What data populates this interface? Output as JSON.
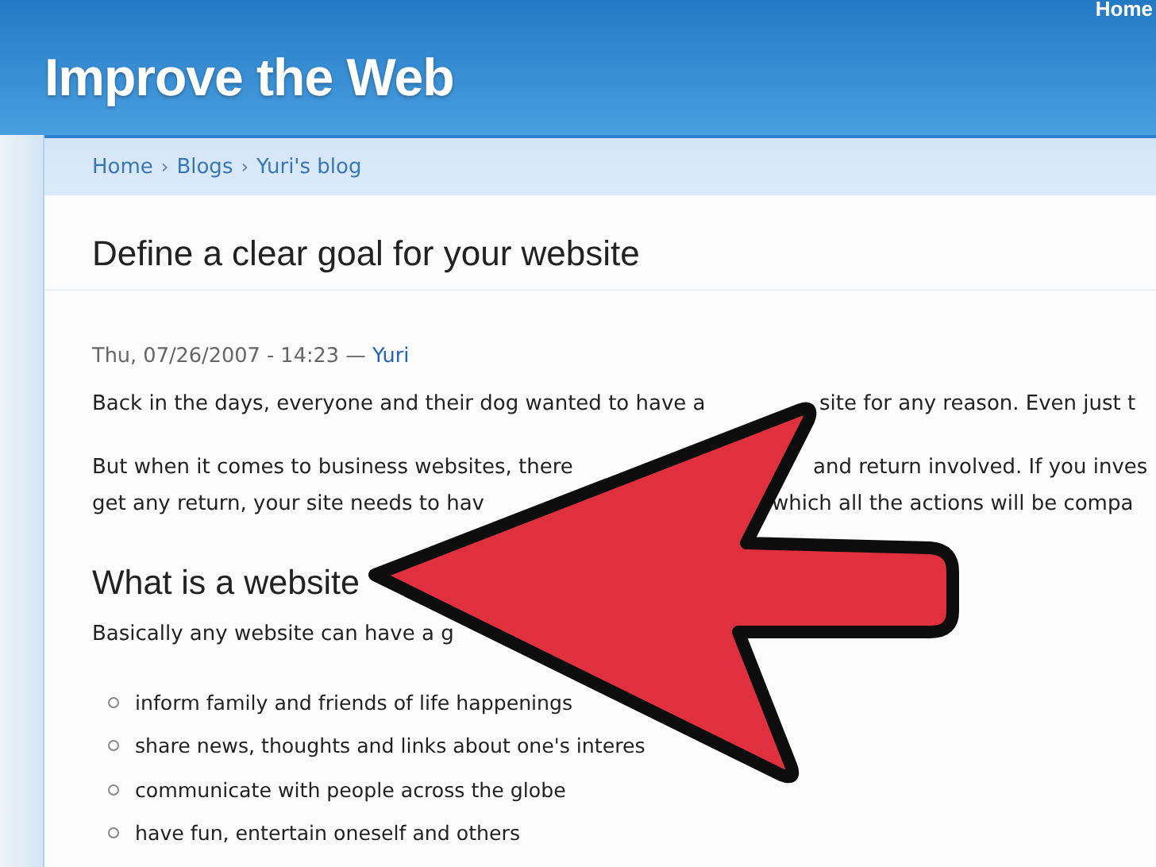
{
  "top_nav": {
    "link": "Home"
  },
  "site_title": "Improve the Web",
  "breadcrumb": {
    "separator": "›",
    "items": [
      "Home",
      "Blogs",
      "Yuri's blog"
    ]
  },
  "post": {
    "title": "Define a clear goal for your website",
    "meta": {
      "date": "Thu, 07/26/2007 - 14:23 —",
      "author": "Yuri"
    },
    "paragraphs": [
      {
        "lines": [
          {
            "left": "Back in the days, everyone and their dog wanted to have a",
            "right": "site for any reason. Even just t"
          }
        ]
      },
      {
        "lines": [
          {
            "left": "But when it comes to business websites, there",
            "right": "and return involved. If you inves"
          },
          {
            "left": "get any return, your site needs to hav",
            "right": "which all the actions will be compa"
          }
        ]
      }
    ],
    "subheading": "What is a website",
    "intro": "Basically any website can have a g",
    "bullets": [
      "inform family and friends of life happenings",
      "share news, thoughts and links about one's interes",
      "communicate with people across the globe",
      "have fun, entertain oneself and others"
    ]
  }
}
